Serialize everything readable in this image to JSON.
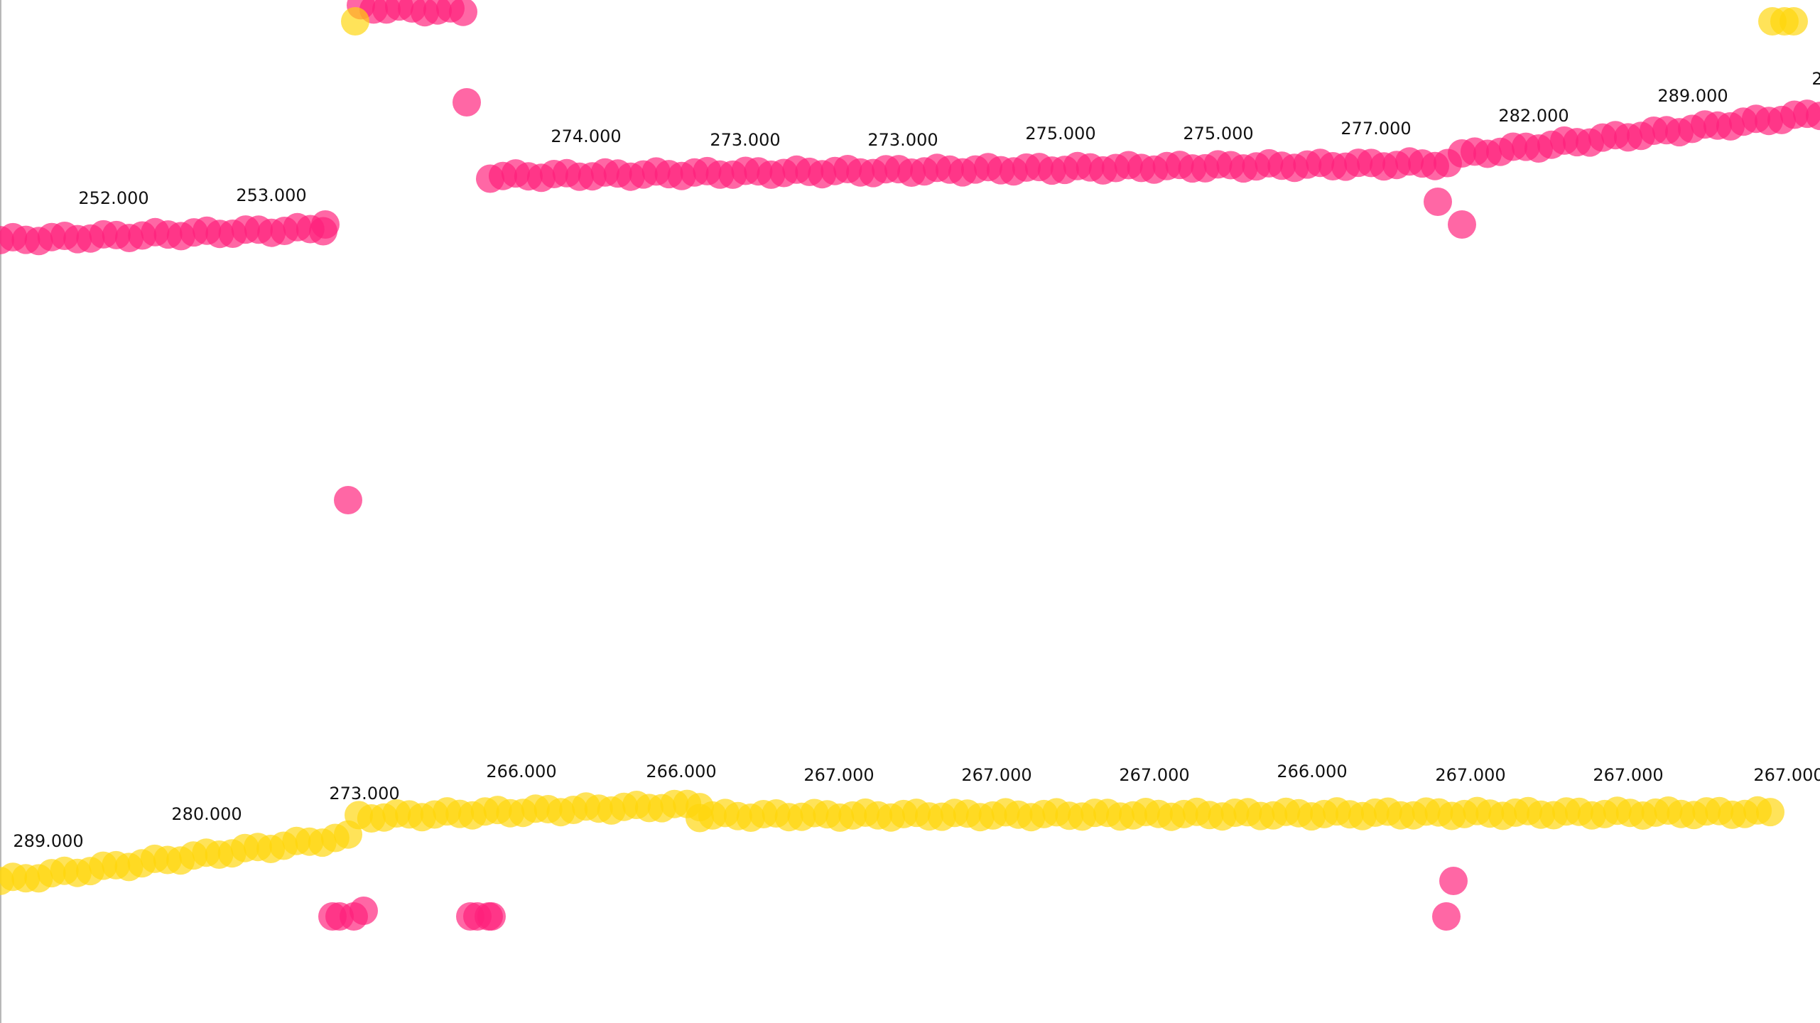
{
  "chart_data": {
    "type": "scatter",
    "title": "",
    "xlabel": "",
    "ylabel": "",
    "grid": false,
    "legend": "none",
    "xlim": [
      0,
      2562
    ],
    "ylim": [
      0,
      1440
    ],
    "colors": {
      "pink": "#ff1f7a",
      "yellow": "#ffd60a"
    },
    "series": [
      {
        "color": "pink",
        "segments": [
          {
            "x0": 0,
            "x1": 455,
            "y0": 1102,
            "y1": 1118
          },
          {
            "x0": 508,
            "x1": 652,
            "y0": 1430,
            "y1": 1424
          },
          {
            "x0": 690,
            "x1": 2038,
            "y0": 1192,
            "y1": 1210
          },
          {
            "x0": 2058,
            "x1": 2562,
            "y0": 1222,
            "y1": 1280
          }
        ],
        "points": [
          {
            "x": 458,
            "y": 1124
          },
          {
            "x": 490,
            "y": 736
          },
          {
            "x": 657,
            "y": 1296
          },
          {
            "x": 2024,
            "y": 1156
          },
          {
            "x": 2058,
            "y": 1124
          },
          {
            "x": 468,
            "y": 150
          },
          {
            "x": 478,
            "y": 150
          },
          {
            "x": 498,
            "y": 150
          },
          {
            "x": 512,
            "y": 158
          },
          {
            "x": 662,
            "y": 150
          },
          {
            "x": 672,
            "y": 150
          },
          {
            "x": 688,
            "y": 150
          },
          {
            "x": 692,
            "y": 150
          },
          {
            "x": 2046,
            "y": 200
          },
          {
            "x": 2036,
            "y": 150
          }
        ],
        "labels": [
          {
            "x": 160,
            "y": 1153,
            "text": "252.000"
          },
          {
            "x": 382,
            "y": 1157,
            "text": "253.000"
          },
          {
            "x": 825,
            "y": 1240,
            "text": "274.000"
          },
          {
            "x": 1049,
            "y": 1235,
            "text": "273.000"
          },
          {
            "x": 1271,
            "y": 1235,
            "text": "273.000"
          },
          {
            "x": 1493,
            "y": 1244,
            "text": "275.000"
          },
          {
            "x": 1715,
            "y": 1244,
            "text": "275.000"
          },
          {
            "x": 1937,
            "y": 1251,
            "text": "277.000"
          },
          {
            "x": 2159,
            "y": 1269,
            "text": "282.000"
          },
          {
            "x": 2383,
            "y": 1297,
            "text": "289.000"
          },
          {
            "x": 2558,
            "y": 1321,
            "text": "2"
          }
        ]
      },
      {
        "color": "yellow",
        "segments": [
          {
            "x0": 0,
            "x1": 490,
            "y0": 200,
            "y1": 262
          },
          {
            "x0": 505,
            "x1": 985,
            "y0": 290,
            "y1": 307
          },
          {
            "x0": 985,
            "x1": 2492,
            "y0": 292,
            "y1": 296
          }
        ],
        "points": [
          {
            "x": 500,
            "y": 1410
          },
          {
            "x": 2495,
            "y": 1410
          },
          {
            "x": 2512,
            "y": 1410
          },
          {
            "x": 2525,
            "y": 1410
          }
        ],
        "labels": [
          {
            "x": 68,
            "y": 248,
            "text": "289.000"
          },
          {
            "x": 291,
            "y": 286,
            "text": "280.000"
          },
          {
            "x": 513,
            "y": 315,
            "text": "273.000"
          },
          {
            "x": 734,
            "y": 346,
            "text": "266.000"
          },
          {
            "x": 959,
            "y": 346,
            "text": "266.000"
          },
          {
            "x": 1181,
            "y": 341,
            "text": "267.000"
          },
          {
            "x": 1403,
            "y": 341,
            "text": "267.000"
          },
          {
            "x": 1625,
            "y": 341,
            "text": "267.000"
          },
          {
            "x": 1847,
            "y": 346,
            "text": "266.000"
          },
          {
            "x": 2070,
            "y": 341,
            "text": "267.000"
          },
          {
            "x": 2292,
            "y": 341,
            "text": "267.000"
          },
          {
            "x": 2518,
            "y": 341,
            "text": "267.000"
          }
        ]
      }
    ]
  }
}
